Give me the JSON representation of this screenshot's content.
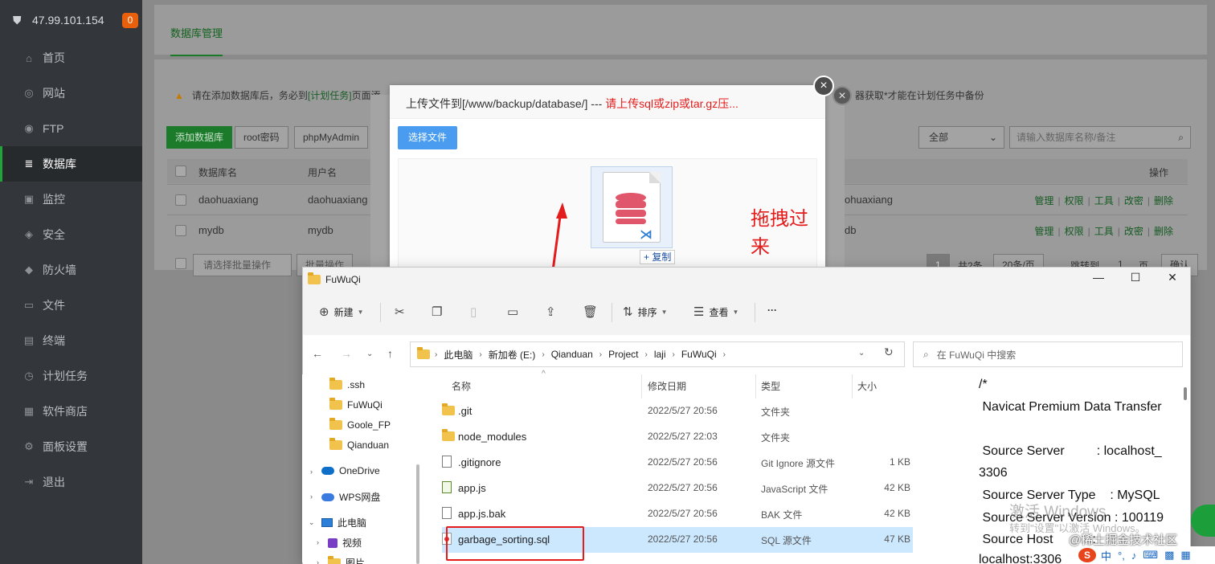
{
  "sidebar": {
    "ip": "47.99.101.154",
    "badge": "0",
    "items": [
      {
        "label": "首页",
        "icon": "home-icon"
      },
      {
        "label": "网站",
        "icon": "globe-icon"
      },
      {
        "label": "FTP",
        "icon": "ftp-icon"
      },
      {
        "label": "数据库",
        "icon": "database-icon"
      },
      {
        "label": "监控",
        "icon": "monitor-icon"
      },
      {
        "label": "安全",
        "icon": "shield-icon"
      },
      {
        "label": "防火墙",
        "icon": "firewall-icon"
      },
      {
        "label": "文件",
        "icon": "folder-icon"
      },
      {
        "label": "终端",
        "icon": "terminal-icon"
      },
      {
        "label": "计划任务",
        "icon": "clock-icon"
      },
      {
        "label": "软件商店",
        "icon": "grid-icon"
      },
      {
        "label": "面板设置",
        "icon": "settings-icon"
      },
      {
        "label": "退出",
        "icon": "logout-icon"
      }
    ],
    "active_index": 3
  },
  "main": {
    "tab": "数据库管理",
    "warning": {
      "before": "请在添加数据库后，务必到",
      "link": "[计划任务]",
      "after": "页面添",
      "tail": "器获取*才能在计划任务中备份"
    },
    "buttons": {
      "add_db": "添加数据库",
      "root_pw": "root密码",
      "phpmyadmin": "phpMyAdmin"
    },
    "filter_select": "全部",
    "search_placeholder": "请输入数据库名称/备注",
    "table": {
      "headers": [
        "数据库名",
        "用户名",
        "操作"
      ],
      "rows": [
        {
          "name": "daohuaxiang",
          "user": "daohuaxiang",
          "note": "ohuaxiang"
        },
        {
          "name": "mydb",
          "user": "mydb",
          "note": "db"
        }
      ],
      "ops": [
        "管理",
        "权限",
        "工具",
        "改密",
        "删除"
      ]
    },
    "batch": {
      "select": "请选择批量操作",
      "btn": "批量操作"
    },
    "pager": {
      "page": "1",
      "total": "共2条",
      "per_page": "20条/页",
      "jump": "跳转到",
      "jump_val": "1",
      "unit": "页",
      "confirm": "确认"
    }
  },
  "upload_dialog": {
    "title": "上传文件到[/www/backup/database/] --- ",
    "title_warning": "请上传sql或zip或tar.gz压...",
    "choose_btn": "选择文件",
    "drag_annotation": "拖拽过来",
    "copy_tip": "+ 复制"
  },
  "explorer": {
    "title": "FuWuQi",
    "toolbar": {
      "new": "新建",
      "sort": "排序",
      "view": "查看",
      "more": "···"
    },
    "breadcrumb": [
      "此电脑",
      "新加卷 (E:)",
      "Qianduan",
      "Project",
      "laji",
      "FuWuQi"
    ],
    "search_placeholder": "在 FuWuQi 中搜索",
    "tree": [
      {
        "label": ".ssh",
        "type": "folder"
      },
      {
        "label": "FuWuQi",
        "type": "folder"
      },
      {
        "label": "Goole_FP",
        "type": "folder"
      },
      {
        "label": "Qianduan",
        "type": "folder"
      },
      {
        "label": "OneDrive",
        "type": "cloud"
      },
      {
        "label": "WPS网盘",
        "type": "wps"
      },
      {
        "label": "此电脑",
        "type": "pc"
      },
      {
        "label": "视频",
        "type": "video"
      },
      {
        "label": "图片",
        "type": "folder"
      }
    ],
    "columns": [
      "名称",
      "修改日期",
      "类型",
      "大小"
    ],
    "files": [
      {
        "name": ".git",
        "date": "2022/5/27 20:56",
        "type": "文件夹",
        "size": "",
        "icon": "folder-icon"
      },
      {
        "name": "node_modules",
        "date": "2022/5/27 22:03",
        "type": "文件夹",
        "size": "",
        "icon": "folder-icon"
      },
      {
        "name": ".gitignore",
        "date": "2022/5/27 20:56",
        "type": "Git Ignore 源文件",
        "size": "1 KB",
        "icon": "file-icon"
      },
      {
        "name": "app.js",
        "date": "2022/5/27 20:56",
        "type": "JavaScript 文件",
        "size": "42 KB",
        "icon": "js-file-icon"
      },
      {
        "name": "app.js.bak",
        "date": "2022/5/27 20:56",
        "type": "BAK 文件",
        "size": "42 KB",
        "icon": "file-icon"
      },
      {
        "name": "garbage_sorting.sql",
        "date": "2022/5/27 20:56",
        "type": "SQL 源文件",
        "size": "47 KB",
        "icon": "sql-file-icon"
      }
    ],
    "selected_index": 5,
    "preview_lines": [
      "/*",
      " Navicat Premium Data Transfer",
      "",
      " Source Server         : localhost_",
      "3306",
      " Source Server Type    : MySQL",
      " Source Server Version : 100119",
      " Source Host           :",
      "localhost:3306"
    ]
  },
  "overlay": {
    "watermark_line1": "激活 Windows",
    "watermark_line2": "转到\"设置\"以激活 Windows。",
    "site_mark": "@稀土掘金技术社区",
    "ime": "中"
  }
}
